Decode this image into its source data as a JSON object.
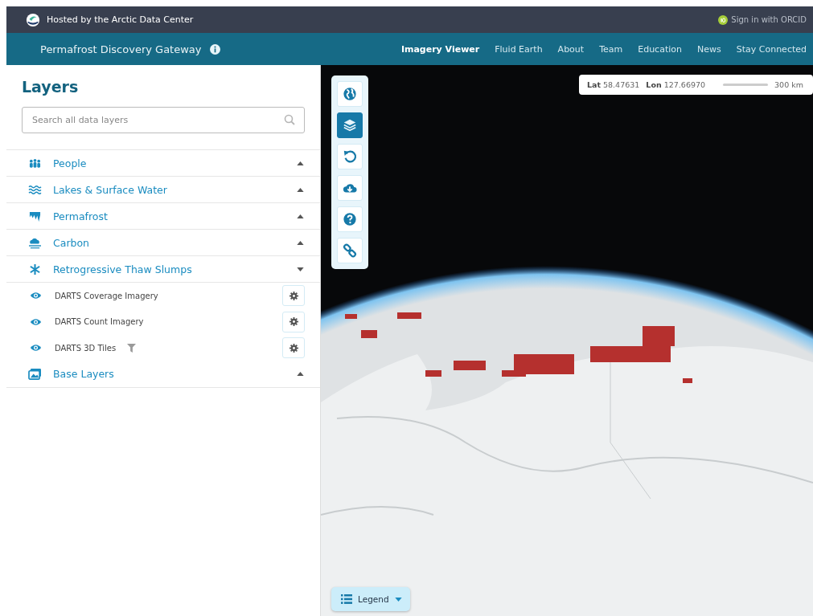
{
  "topbar": {
    "host_text": "Hosted by the Arctic Data Center",
    "signin": "Sign in with ORCID"
  },
  "navbar": {
    "title": "Permafrost Discovery Gateway",
    "links": [
      {
        "label": "Imagery Viewer",
        "selected": true
      },
      {
        "label": "Fluid Earth",
        "selected": false
      },
      {
        "label": "About",
        "selected": false
      },
      {
        "label": "Team",
        "selected": false
      },
      {
        "label": "Education",
        "selected": false
      },
      {
        "label": "News",
        "selected": false
      },
      {
        "label": "Stay Connected",
        "selected": false
      }
    ]
  },
  "sidebar": {
    "title": "Layers",
    "search": {
      "placeholder": "Search all data layers"
    },
    "categories": [
      {
        "kind": "people",
        "label": "People",
        "expanded": false
      },
      {
        "kind": "water",
        "label": "Lakes & Surface Water",
        "expanded": false
      },
      {
        "kind": "permafrost",
        "label": "Permafrost",
        "expanded": false
      },
      {
        "kind": "carbon",
        "label": "Carbon",
        "expanded": false
      },
      {
        "kind": "slumps",
        "label": "Retrogressive Thaw Slumps",
        "expanded": true,
        "layers": [
          {
            "label": "DARTS Coverage Imagery",
            "visible": true,
            "filtered": false
          },
          {
            "label": "DARTS Count Imagery",
            "visible": true,
            "filtered": false
          },
          {
            "label": "DARTS 3D Tiles",
            "visible": true,
            "filtered": true
          }
        ]
      },
      {
        "kind": "base",
        "label": "Base Layers",
        "expanded": false
      }
    ]
  },
  "map": {
    "tools": [
      {
        "kind": "globe",
        "selected": false
      },
      {
        "kind": "layers",
        "selected": true
      },
      {
        "kind": "reset",
        "selected": false
      },
      {
        "kind": "download",
        "selected": false
      },
      {
        "kind": "help",
        "selected": false
      },
      {
        "kind": "link",
        "selected": false
      }
    ],
    "coordinates": {
      "lat_label": "Lat",
      "lat": "58.47631",
      "lon_label": "Lon",
      "lon": "127.66970",
      "scale": "300 km"
    },
    "legend": {
      "label": "Legend"
    }
  }
}
